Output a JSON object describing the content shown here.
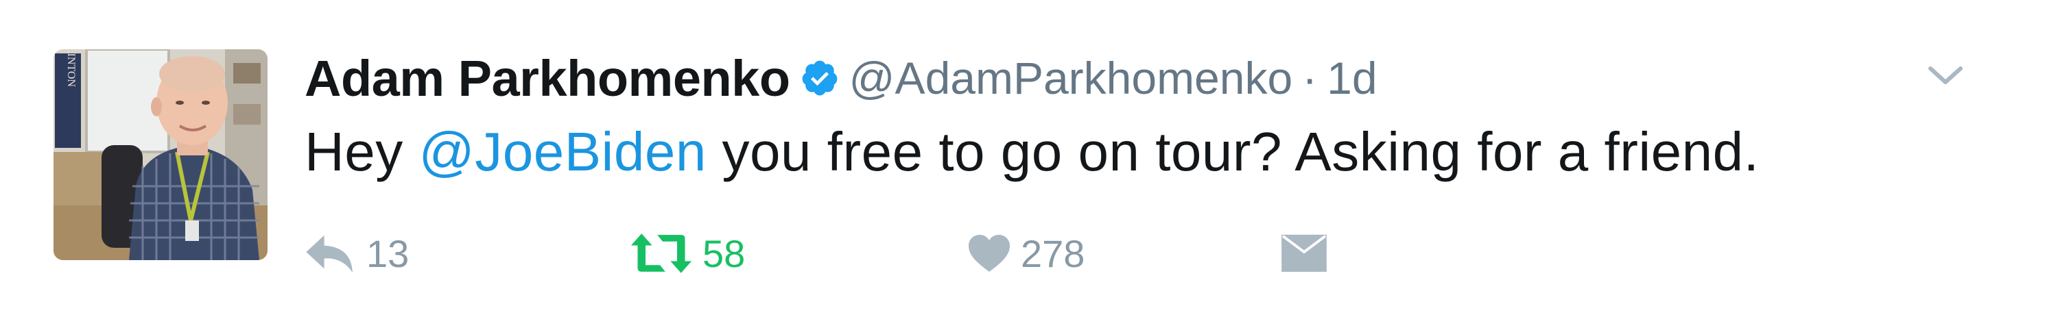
{
  "tweet": {
    "display_name": "Adam Parkhomenko",
    "verified": true,
    "handle": "@AdamParkhomenko",
    "separator": "·",
    "timestamp": "1d",
    "text_before": "Hey ",
    "mention": "@JoeBiden",
    "text_after": " you free to go on tour? Asking for a friend."
  },
  "actions": {
    "reply_count": "13",
    "retweet_count": "58",
    "like_count": "278"
  },
  "icons": {
    "verified": "verified-badge-icon",
    "more": "chevron-down-icon",
    "reply": "reply-icon",
    "retweet": "retweet-icon",
    "like": "heart-icon",
    "dm": "envelope-icon"
  },
  "colors": {
    "name": "#14171a",
    "secondary": "#657786",
    "mention": "#1b95e0",
    "verified": "#1da1f2",
    "retweet_active": "#17bf63",
    "icon_gray": "#aab8c2"
  },
  "avatar": {
    "sign_text": "CLINTON"
  }
}
